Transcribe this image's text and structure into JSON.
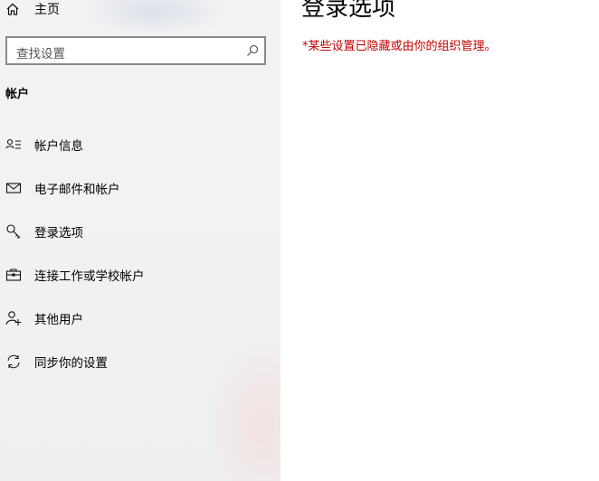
{
  "sidebar": {
    "home_label": "主页",
    "search_placeholder": "查找设置",
    "section_title": "帐户",
    "items": [
      {
        "label": "帐户信息",
        "icon": "account-info-icon"
      },
      {
        "label": "电子邮件和帐户",
        "icon": "mail-icon"
      },
      {
        "label": "登录选项",
        "icon": "key-icon"
      },
      {
        "label": "连接工作或学校帐户",
        "icon": "briefcase-icon"
      },
      {
        "label": "其他用户",
        "icon": "add-user-icon"
      },
      {
        "label": "同步你的设置",
        "icon": "sync-icon"
      }
    ]
  },
  "main": {
    "title": "登录选项",
    "policy_note": "*某些设置已隐藏或由你的组织管理。",
    "policy_color": "#c40000"
  }
}
